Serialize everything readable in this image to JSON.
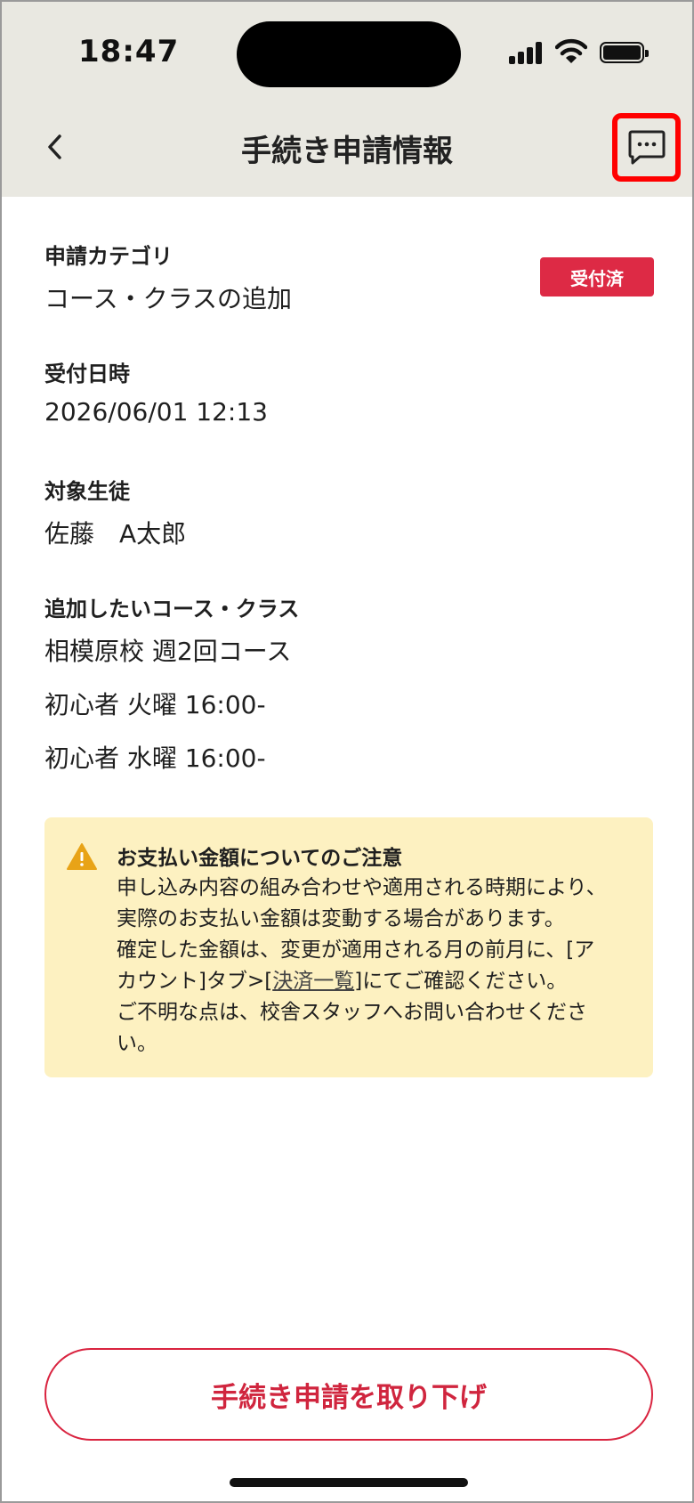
{
  "status_bar": {
    "time": "18:47"
  },
  "header": {
    "title": "手続き申請情報"
  },
  "fields": [
    {
      "label": "申請カテゴリ",
      "value": "コース・クラスの追加"
    },
    {
      "label": "受付日時",
      "value": "2026/06/01 12:13"
    },
    {
      "label": "対象生徒",
      "value": "佐藤　A太郎"
    },
    {
      "label": "追加したいコース・クラス",
      "values": [
        "相模原校 週2回コース",
        "初心者 火曜 16:00-",
        "初心者 水曜  16:00-"
      ]
    }
  ],
  "status_badge": {
    "label": "受付済",
    "color": "#dd2a45"
  },
  "notice": {
    "title": "お支払い金額についてのご注意",
    "line1": "申し込み内容の組み合わせや適用される時期により、",
    "line2": "実際のお支払い金額は変動する場合があります。",
    "line3": "確定した金額は、変更が適用される月の前月に、[ア",
    "line4_prefix": "カウント]タブ>[",
    "line4_link": "決済一覧",
    "line4_suffix": "]にてご確認ください。",
    "line5": "ご不明な点は、校舎スタッフへお問い合わせくださ",
    "line6": "い。",
    "background": "#fdf1c1",
    "icon": "warning-icon"
  },
  "actions": {
    "withdraw_label": "手続き申請を取り下げ"
  },
  "icons": {
    "back": "chevron-left-icon",
    "message": "chat-bubble-icon"
  },
  "colors": {
    "accent": "#d0253e",
    "header_bg": "#e9e8e1",
    "highlight": "#ff0000"
  }
}
